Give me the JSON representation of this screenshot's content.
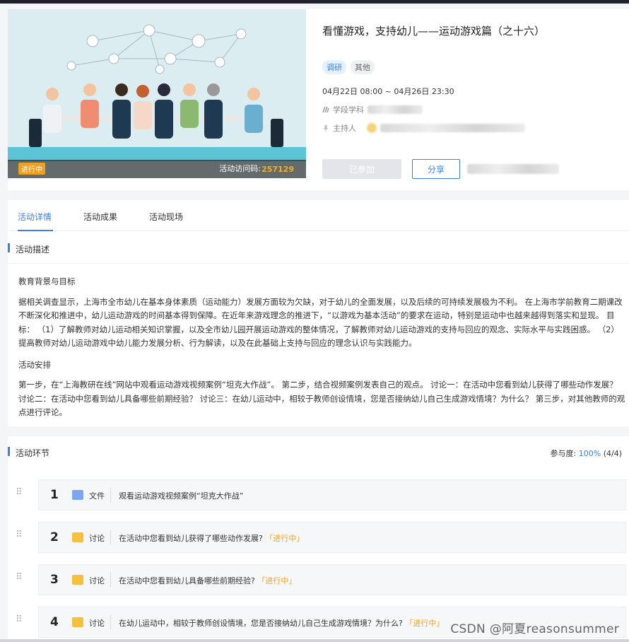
{
  "activity": {
    "title": "看懂游戏，支持幼儿——运动游戏篇（之十六）",
    "tags": [
      "调研",
      "其他"
    ],
    "time_range": "04月22日 08:00 ~ 04月26日 23:30",
    "stage_label": "学段学科",
    "host_label": "主持人",
    "status_badge": "进行中",
    "access_code_label": "活动访问码:",
    "access_code": "257129",
    "joined_button": "已参加",
    "share_button": "分享"
  },
  "tabs": [
    {
      "label": "活动详情",
      "active": true
    },
    {
      "label": "活动成果",
      "active": false
    },
    {
      "label": "活动现场",
      "active": false
    }
  ],
  "description": {
    "section_title": "活动描述",
    "heading1": "教育背景与目标",
    "para1": "据相关调查显示，上海市全市幼儿在基本身体素质（运动能力）发展方面较为欠缺，对于幼儿的全面发展，以及后续的可持续发展极为不利。 在上海市学前教育二期课改不断深化和推进中，幼儿运动游戏的时间基本得到保障。在近年来游戏理念的推进下，“以游戏为基本活动”的要求在运动，特别是运动中也越来越得到落实和显现。 目标： （1）了解教师对幼儿运动相关知识掌握，以及全市幼儿园开展运动游戏的整体情况，了解教师对幼儿运动游戏的支持与回应的观念、实际水平与实践困惑。 （2）提高教师对幼儿运动游戏中幼儿能力发展分析、行为解读，以及在此基础上支持与回应的理念认识与实践能力。",
    "heading2": "活动安排",
    "para2": "第一步，在“上海教研在线”网站中观看运动游戏视频案例“坦克大作战”。 第二步，结合视频案例发表自己的观点。 讨论一：在活动中您看到幼儿获得了哪些动作发展？ 讨论二：在活动中您看到幼儿具备哪些前期经验？ 讨论三：在幼儿运动中，相较于教师创设情境，您是否接纳幼儿自己生成游戏情境？为什么？ 第三步，对其他教师的观点进行评论。"
  },
  "steps": {
    "section_title": "活动环节",
    "participation_label": "参与度:",
    "participation_pct": "100%",
    "participation_count": "(4/4)",
    "items": [
      {
        "num": "1",
        "type": "文件",
        "text": "观看运动游戏视频案例“坦克大作战”",
        "status": ""
      },
      {
        "num": "2",
        "type": "讨论",
        "text": "在活动中您看到幼儿获得了哪些动作发展?",
        "status": "「进行中」"
      },
      {
        "num": "3",
        "type": "讨论",
        "text": "在活动中您看到幼儿具备哪些前期经验?",
        "status": "「进行中」"
      },
      {
        "num": "4",
        "type": "讨论",
        "text": "在幼儿运动中，相较于教师创设情境，您是否接纳幼儿自己生成游戏情境？为什么?",
        "status": "「进行中」"
      }
    ]
  },
  "watermark": "CSDN @阿夏reasonsummer",
  "colors": {
    "accent": "#3d7fd9",
    "warning": "#f0a020",
    "file_icon": "#7aa7f0",
    "discussion_icon": "#f5c040"
  }
}
